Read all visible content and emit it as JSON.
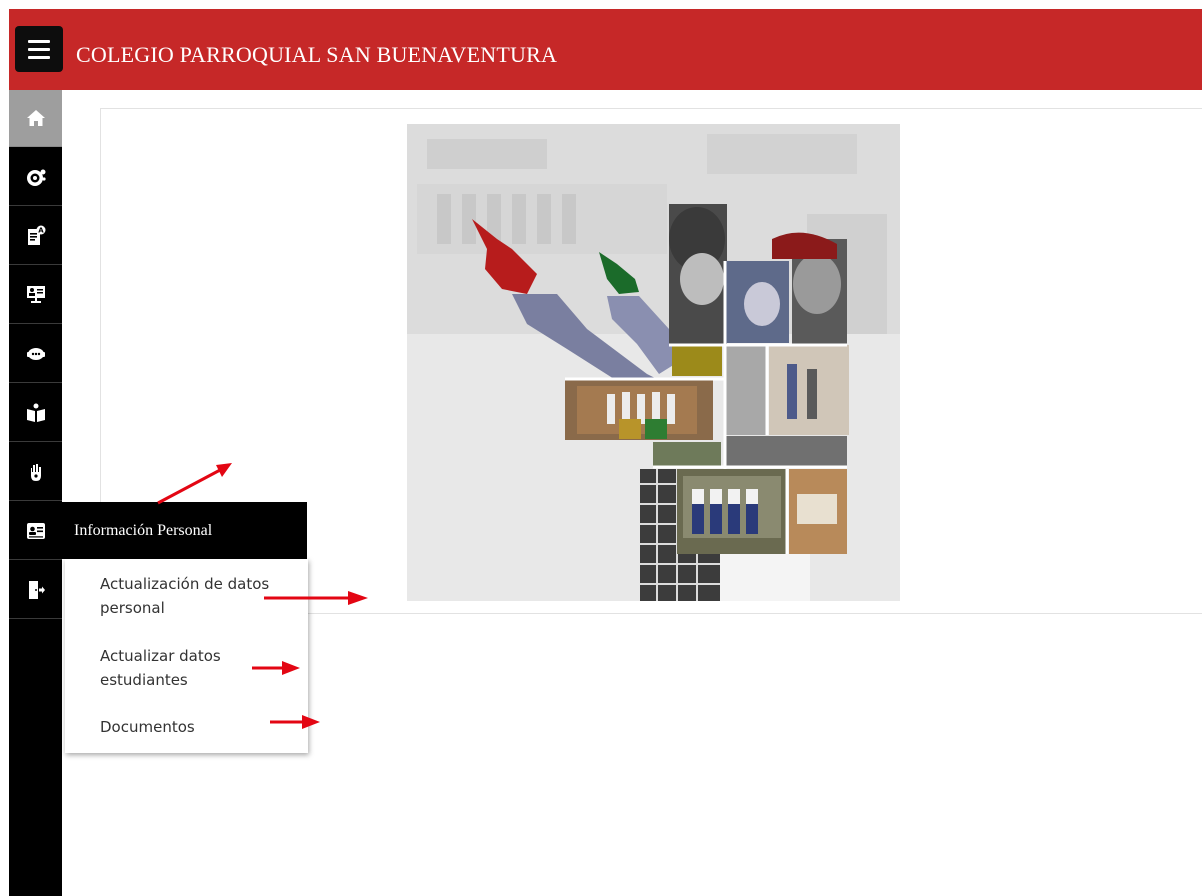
{
  "header": {
    "title": "COLEGIO PARROQUIAL SAN BUENAVENTURA",
    "menu_icon": "hamburger-icon",
    "background_color": "#c62828"
  },
  "sidebar": {
    "items": [
      {
        "icon": "home-icon",
        "active": true
      },
      {
        "icon": "dashboard-gauge-icon"
      },
      {
        "icon": "report-card-icon"
      },
      {
        "icon": "teacher-board-icon"
      },
      {
        "icon": "chat-support-icon"
      },
      {
        "icon": "reading-book-icon"
      },
      {
        "icon": "hand-icon"
      },
      {
        "icon": "id-card-icon",
        "label": "Información Personal",
        "expanded": true
      },
      {
        "icon": "exit-door-icon"
      }
    ]
  },
  "submenu": {
    "title": "Información Personal",
    "items": [
      {
        "label": "Actualización de datos personal"
      },
      {
        "label": "Actualizar datos estudiantes"
      },
      {
        "label": "Documentos"
      }
    ]
  },
  "main": {
    "image": "school-collage-image"
  },
  "colors": {
    "brand_red": "#c62828",
    "sidebar_black": "#000000",
    "annotation_red": "#e30613"
  }
}
